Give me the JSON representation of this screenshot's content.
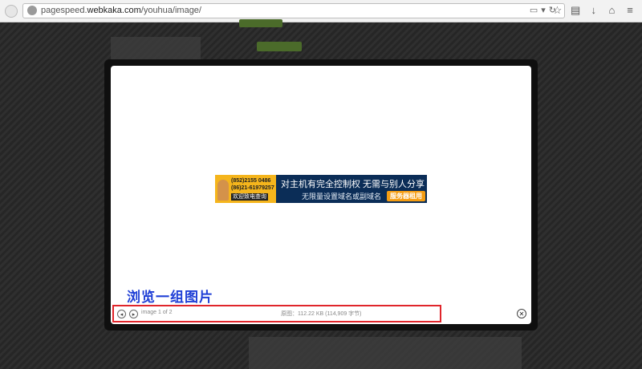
{
  "browser": {
    "url_prefix": "pagespeed.",
    "url_domain": "webkaka.com",
    "url_path": "/youhua/image/"
  },
  "banner": {
    "phone1": "(852)2155 0486",
    "phone2": "(86)21-61979257",
    "call_label": "欢迎致电查询",
    "headline": "对主机有完全控制权 无需与别人分享",
    "subline": "无限量设置域名或副域名",
    "button": "服务器租用"
  },
  "lightbox": {
    "caption": "浏览一组图片",
    "counter": "image 1 of 2",
    "filesize": "原图：112.22 KB (114,909 字节)",
    "prev_glyph": "◂",
    "next_glyph": "▸",
    "close_glyph": "✕"
  },
  "colors": {
    "caption_blue": "#1f3fd6",
    "highlight_red": "#e0252b",
    "banner_navy": "#0b2d57",
    "banner_orange": "#f5b51c"
  }
}
